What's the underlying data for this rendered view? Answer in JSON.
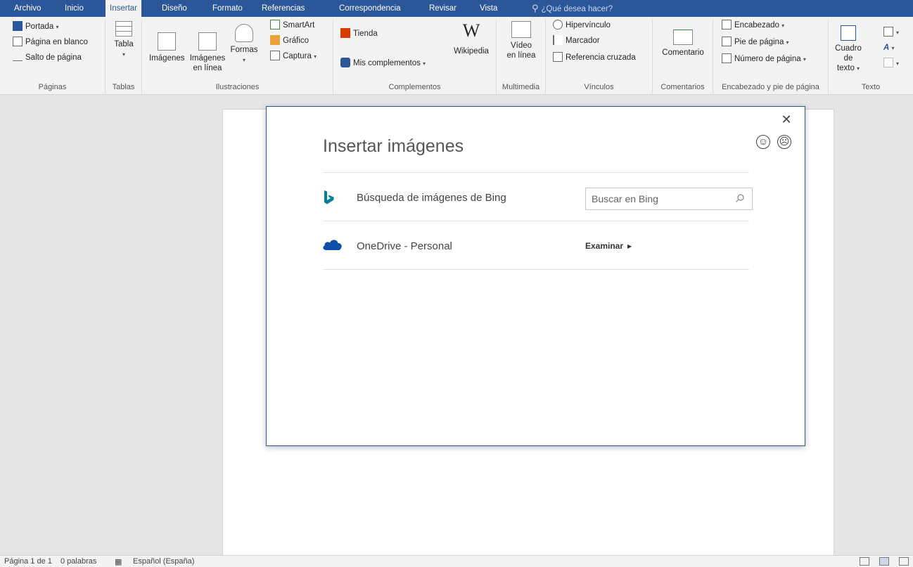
{
  "tabs": [
    {
      "label": "Archivo"
    },
    {
      "label": "Inicio"
    },
    {
      "label": "Insertar"
    },
    {
      "label": "Diseño"
    },
    {
      "label": "Formato"
    },
    {
      "label": "Referencias"
    },
    {
      "label": "Correspondencia"
    },
    {
      "label": "Revisar"
    },
    {
      "label": "Vista"
    }
  ],
  "tell_me": {
    "placeholder": "¿Qué desea hacer?",
    "icon": "lightbulb-icon"
  },
  "ribbon": {
    "paginas": {
      "label": "Páginas",
      "portada": "Portada",
      "pagina_blanco": "Página en blanco",
      "salto": "Salto de página"
    },
    "tablas": {
      "label": "Tablas",
      "tabla": "Tabla"
    },
    "ilustraciones": {
      "label": "Ilustraciones",
      "imagenes": "Imágenes",
      "imagenes_linea_1": "Imágenes",
      "imagenes_linea_2": "en línea",
      "formas": "Formas",
      "smartart": "SmartArt",
      "grafico": "Gráfico",
      "captura": "Captura"
    },
    "complementos": {
      "label": "Complementos",
      "tienda": "Tienda",
      "mis": "Mis complementos",
      "wikipedia": "Wikipedia",
      "wiki_glyph": "W"
    },
    "multimedia": {
      "label": "Multimedia",
      "video_1": "Vídeo",
      "video_2": "en línea"
    },
    "vinculos": {
      "label": "Vínculos",
      "hipervinculo": "Hipervínculo",
      "marcador": "Marcador",
      "referencia": "Referencia cruzada"
    },
    "comentarios": {
      "label": "Comentarios",
      "comentario": "Comentario"
    },
    "encabezado": {
      "label": "Encabezado y pie de página",
      "encabezado": "Encabezado",
      "pie": "Pie de página",
      "numero": "Número de página"
    },
    "texto": {
      "label": "Texto",
      "cuadro_1": "Cuadro de",
      "cuadro_2": "texto"
    }
  },
  "dialog": {
    "title": "Insertar imágenes",
    "close_glyph": "✕",
    "smile_glyph": "☺",
    "frown_glyph": "☹",
    "bing": {
      "label": "Búsqueda de imágenes de Bing",
      "placeholder": "Buscar en Bing",
      "icon": "bing-logo-icon",
      "color": "#00809d"
    },
    "onedrive": {
      "label": "OneDrive - Personal",
      "browse": "Examinar",
      "icon": "onedrive-cloud-icon",
      "color": "#0f4fa8"
    }
  },
  "statusbar": {
    "page": "Página 1 de 1",
    "words": "0 palabras",
    "language": "Español (España)"
  },
  "colors": {
    "accent": "#2b579a",
    "ribbon_bg": "#f3f3f3",
    "doc_bg": "#e6e6e6"
  }
}
